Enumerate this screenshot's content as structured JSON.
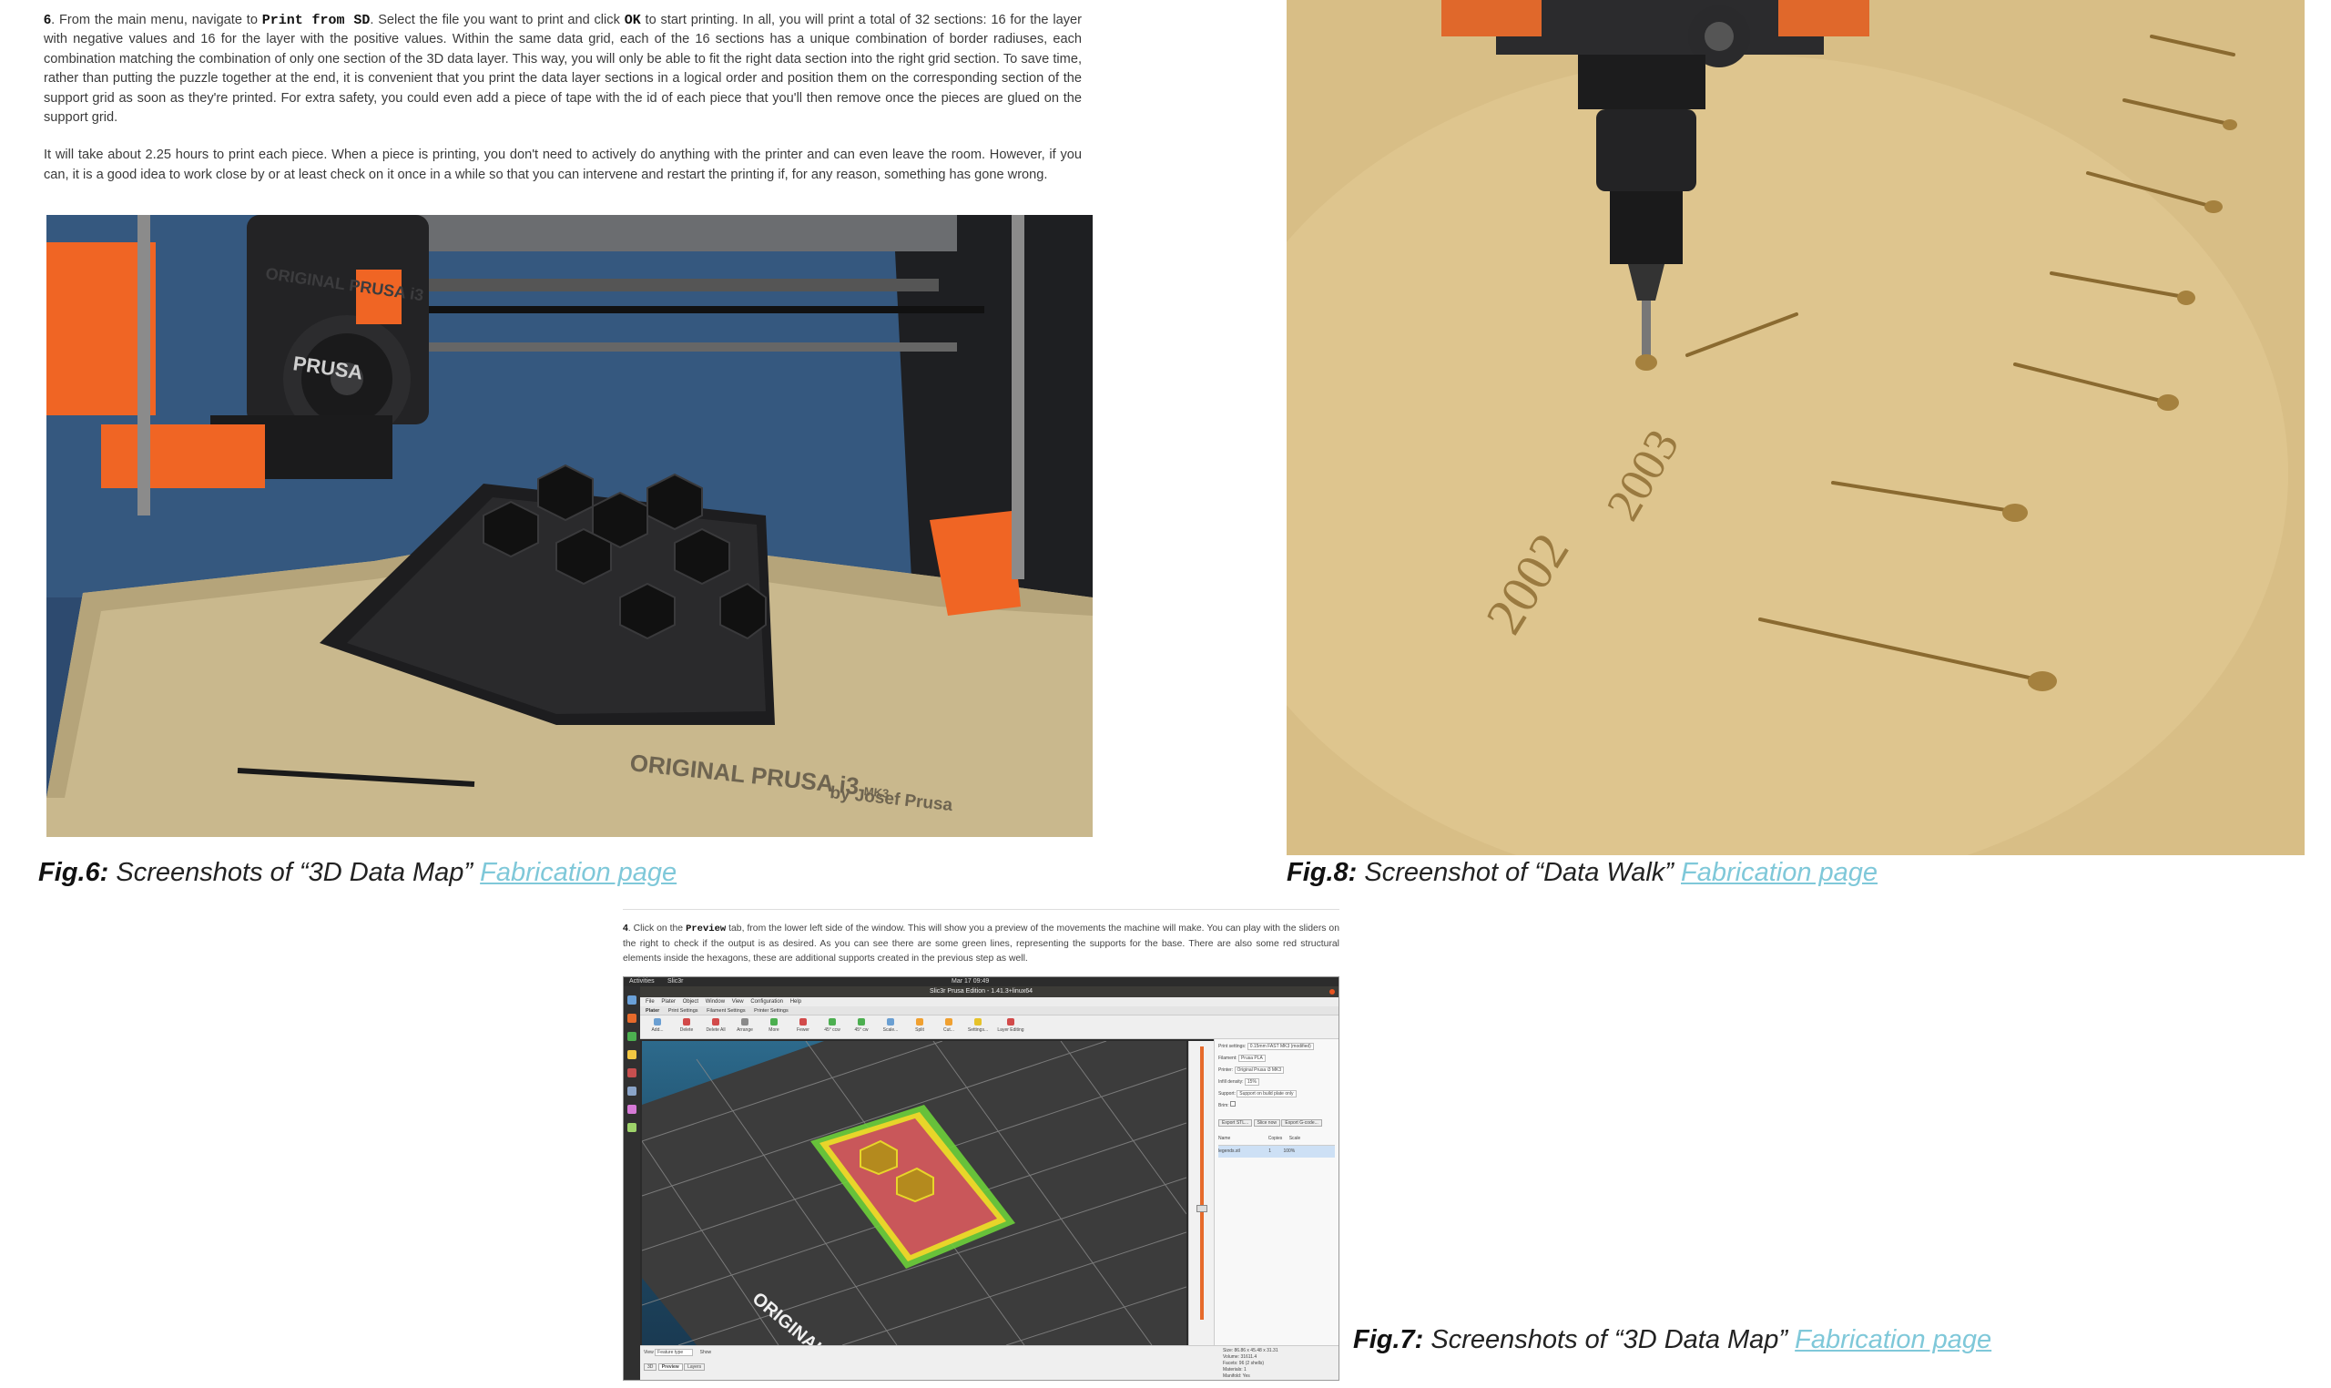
{
  "step6": {
    "number": "6",
    "p1_a": ". From the main menu, navigate to ",
    "p1_code1": "Print from SD",
    "p1_b": ". Select the file you want to print and click ",
    "p1_code2": "OK",
    "p1_c": " to start printing. In all, you will print a total of 32 sections: 16 for the layer with negative values and 16 for the layer with the positive values. Within the same data grid, each of the 16 sections has a unique combination of border radiuses, each combination matching the combination of only one section of the 3D data layer. This way, you will only be able to fit the right data section into the right grid section. To save time, rather than putting the puzzle together at the end, it is convenient that you print the data layer sections in a logical order and position them on the corresponding section of the support grid as soon as they're printed. For extra safety, you could even add a piece of tape with the id of each piece that you'll then remove once the pieces are glued on the support grid.",
    "p2": "It will take about 2.25 hours to print each piece. When a piece is printing, you don't need to actively do anything with the printer and can even leave the room. However, if you can, it is a good idea to work close by or at least check on it once in a while so that you can intervene and restart the printing if, for any reason, something has gone wrong."
  },
  "photos": {
    "printer": {
      "brand_plate": "ORIGINAL PRUSA i3",
      "model": "MK3",
      "byline": "by Josef Prusa",
      "head_label": "ORIGINAL PRUSA i3",
      "prusa": "PRUSA"
    },
    "cnc": {
      "year_2002": "2002",
      "year_2003": "2003"
    },
    "slicer": {
      "topbar_left": "Activities",
      "topbar_app": "Slic3r",
      "topbar_time": "Mar 17 09:49",
      "window_title": "Slic3r Prusa Edition - 1.41.3+linux64",
      "menu": [
        "File",
        "Plater",
        "Object",
        "Window",
        "View",
        "Configuration",
        "Help"
      ],
      "tabs": [
        "Plater",
        "Print Settings",
        "Filament Settings",
        "Printer Settings"
      ],
      "toolbar": [
        "Add...",
        "Delete",
        "Delete All",
        "Arrange",
        "More",
        "Fewer",
        "45° ccw",
        "45° cw",
        "Scale...",
        "Split",
        "Cut...",
        "Settings...",
        "Layer Editing"
      ],
      "panel": {
        "rows": [
          [
            "Print settings:",
            "0.15mm FAST MK3 (modified)"
          ],
          [
            "Filament:",
            "Prusa PLA"
          ],
          [
            "Printer:",
            "Original Prusa i3 MK3"
          ],
          [
            "Infill density:",
            "15%"
          ],
          [
            "Support:",
            "Support on build plate only"
          ],
          [
            "Brim:",
            ""
          ]
        ],
        "buttons": [
          "Export STL...",
          "Slice now",
          "Export G-code..."
        ],
        "list_headers": [
          "Name",
          "Copies",
          "Scale"
        ],
        "list_row": [
          "legends.stl",
          "1",
          "100%"
        ],
        "info": [
          "Size: 86.86 x 45.48 x 31.31",
          "Volume: 31611.4",
          "Facets: 96 (2 shells)",
          "Materials: 1",
          "Manifold: Yes"
        ]
      },
      "bottom": {
        "view_label": "View",
        "view_value": "Feature type",
        "show_label": "Show",
        "tabs": [
          "3D",
          "Preview",
          "Layers"
        ]
      },
      "plate_text": "ORIGINAL"
    }
  },
  "captions": {
    "fig6": {
      "label": "Fig.6:",
      "text": "Screenshots of “3D Data Map”",
      "link": "Fabrication page"
    },
    "fig8": {
      "label": "Fig.8:",
      "text": "Screenshot of “Data Walk”",
      "link": "Fabrication page"
    },
    "fig7": {
      "label": "Fig.7:",
      "text": "Screenshots of “3D Data Map”",
      "link": "Fabrication page"
    }
  },
  "step4": {
    "number": "4",
    "a": ". Click on the ",
    "code": "Preview",
    "b": " tab, from the lower left side of the window. This will show you a preview of the movements the machine will make. You can play with the sliders on the right to check if the output is as desired. As you can see there are some green lines, representing the supports for the base. There are also some red structural elements inside the hexagons, these are additional supports created in the previous step as well."
  },
  "colors": {
    "link": "#7fc8d9",
    "prusa_orange": "#f06524",
    "print_bed": "#c8b68a",
    "print_black": "#1d1d1f",
    "wood": "#d9bf86",
    "slicer_red": "#c9575a",
    "slicer_green": "#6ccf3a",
    "slicer_yellow": "#e8d52a"
  }
}
